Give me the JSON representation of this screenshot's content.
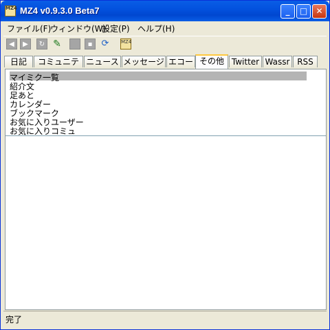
{
  "window": {
    "title": "MZ4 v0.9.3.0 Beta7",
    "icon_label": "mz4-app-icon",
    "controls": {
      "minimize": "_",
      "maximize": "□",
      "close": "✕"
    }
  },
  "menu": [
    "ファイル(F)",
    "ウィンドウ(W)",
    "設定(P)",
    "ヘルプ(H)"
  ],
  "toolbar": {
    "buttons": [
      "back-icon",
      "forward-icon",
      "reload-icon",
      "edit-icon",
      "stop-icon",
      "page-icon",
      "sync-icon",
      "mz4-icon"
    ]
  },
  "tabs": {
    "items": [
      "日記",
      "コミュニティ",
      "ニュース",
      "メッセージ",
      "エコー",
      "その他",
      "Twitter",
      "Wassr",
      "RSS"
    ],
    "active": "その他"
  },
  "list": {
    "items": [
      "マイミク一覧",
      "紹介文",
      "足あと",
      "カレンダー",
      "ブックマーク",
      "お気に入りユーザー",
      "お気に入りコミュ"
    ],
    "selected_index": 0
  },
  "status": {
    "text": "完了"
  },
  "colors": {
    "title_bar": "#0352de",
    "selection": "#b4b4b4",
    "active_tab_accent": "#ffc83c"
  }
}
